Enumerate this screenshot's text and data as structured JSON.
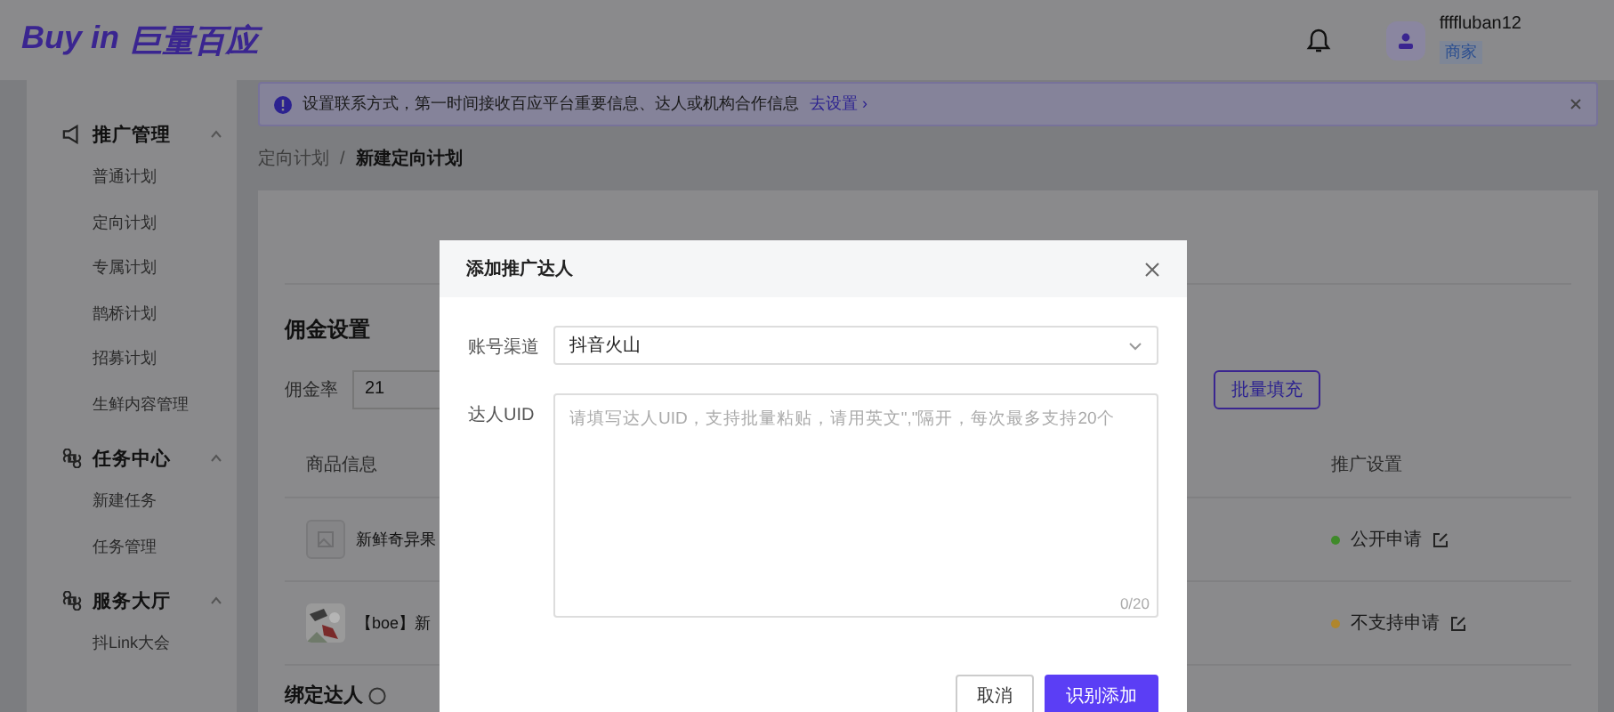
{
  "header": {
    "logo_latin": "Buy in",
    "logo_cn": "巨量百应",
    "user": {
      "name": "ffffluban12",
      "role": "商家"
    }
  },
  "sidebar": {
    "groups": [
      {
        "title": "推广管理",
        "expanded": true,
        "items": [
          "普通计划",
          "定向计划",
          "专属计划",
          "鹊桥计划",
          "招募计划",
          "生鲜内容管理"
        ]
      },
      {
        "title": "任务中心",
        "expanded": true,
        "items": [
          "新建任务",
          "任务管理"
        ]
      },
      {
        "title": "服务大厅",
        "expanded": true,
        "items": [
          "抖Link大会"
        ]
      }
    ]
  },
  "alert": {
    "text": "设置联系方式，第一时间接收百应平台重要信息、达人或机构合作信息",
    "link": "去设置",
    "link_arrow": "›"
  },
  "breadcrumb": {
    "separator": "/",
    "items": [
      {
        "label": "定向计划",
        "current": false
      },
      {
        "label": "新建定向计划",
        "current": true
      }
    ]
  },
  "commission": {
    "title": "佣金设置",
    "rate_label": "佣金率",
    "rate_value": "21",
    "batch_button": "批量填充"
  },
  "table": {
    "columns": [
      "商品信息",
      "推广设置"
    ],
    "rows": [
      {
        "product": "新鲜奇异果",
        "has_image": false,
        "status": "公开申请",
        "color": "#3f8a2a"
      },
      {
        "product": "【boe】新",
        "has_image": true,
        "status": "不支持申请",
        "color": "#b0862c"
      }
    ]
  },
  "bind_title": "绑定达人",
  "modal": {
    "title": "添加推广达人",
    "channel_label": "账号渠道",
    "channel_value": "抖音火山",
    "uid_label": "达人UID",
    "uid_placeholder": "请填写达人UID，支持批量粘贴，请用英文\",\"隔开，每次最多支持20个",
    "counter": "0/20",
    "buttons": [
      {
        "label": "取消",
        "primary": false
      },
      {
        "label": "识别添加",
        "primary": true
      }
    ]
  }
}
